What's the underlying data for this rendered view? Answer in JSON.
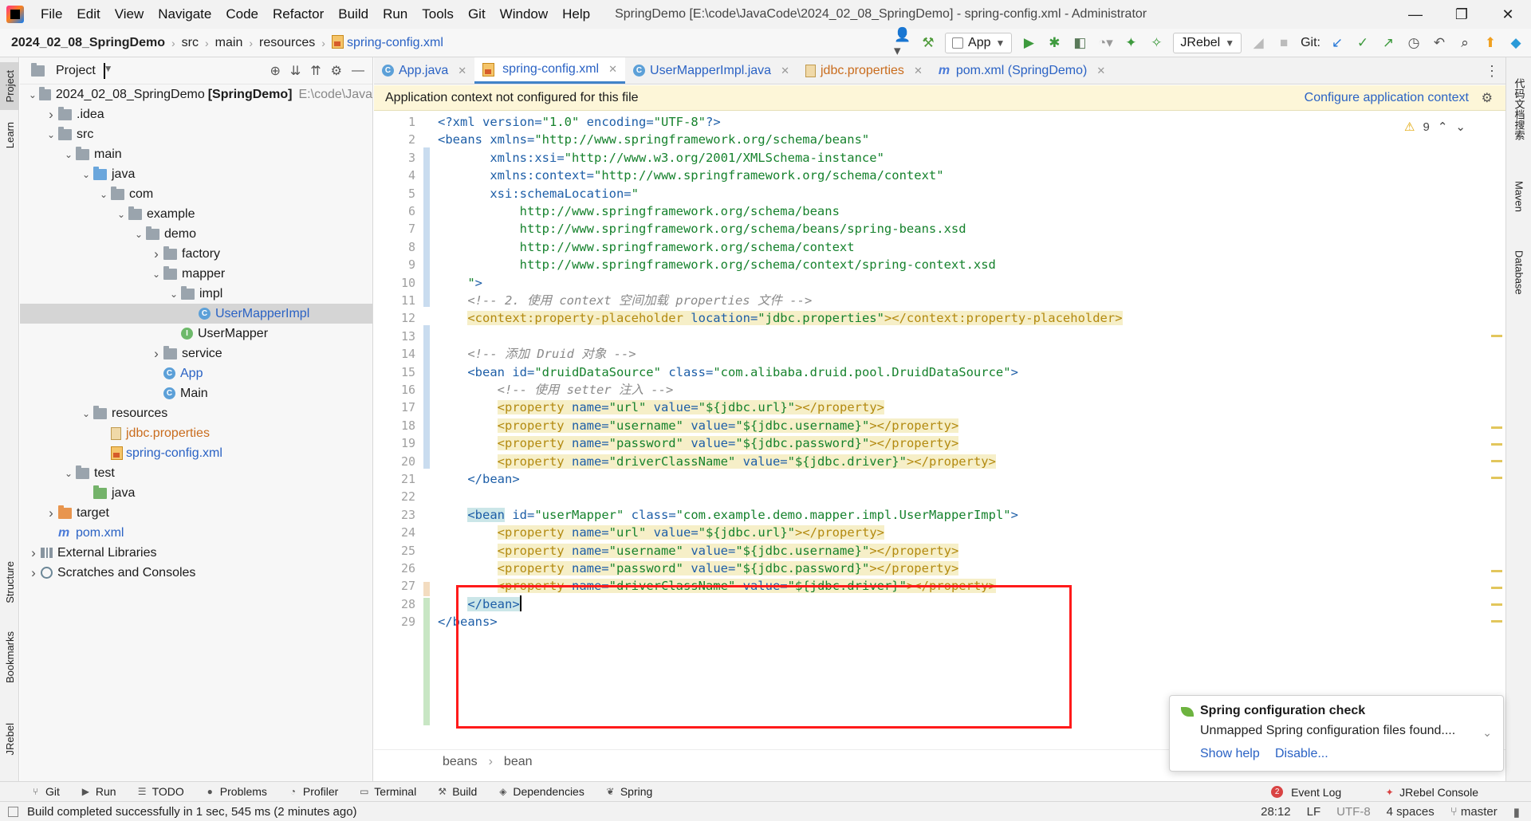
{
  "titlebar": {
    "menu": [
      "File",
      "Edit",
      "View",
      "Navigate",
      "Code",
      "Refactor",
      "Build",
      "Run",
      "Tools",
      "Git",
      "Window",
      "Help"
    ],
    "window_title": "SpringDemo [E:\\code\\JavaCode\\2024_02_08_SpringDemo] - spring-config.xml - Administrator",
    "controls": [
      "—",
      "❐",
      "✕"
    ]
  },
  "navbar": {
    "breadcrumbs": [
      "2024_02_08_SpringDemo",
      "src",
      "main",
      "resources",
      "spring-config.xml"
    ],
    "run_config": "App",
    "jrebel": "JRebel",
    "git_label": "Git:"
  },
  "left_stripe": {
    "tabs": [
      "Project",
      "Learn",
      "Structure",
      "Bookmarks",
      "JRebel"
    ]
  },
  "right_stripe": {
    "tabs": [
      "代码文档搜索",
      "Maven",
      "Database"
    ]
  },
  "project_panel": {
    "title": "Project",
    "tree": [
      {
        "label": "2024_02_08_SpringDemo",
        "bold_suffix": "[SpringDemo]",
        "path": "E:\\code\\Java",
        "icon": "folder",
        "expanded": true,
        "depth": 0
      },
      {
        "label": ".idea",
        "icon": "folder",
        "expanded": false,
        "depth": 1
      },
      {
        "label": "src",
        "icon": "folder",
        "expanded": true,
        "depth": 1
      },
      {
        "label": "main",
        "icon": "folder",
        "expanded": true,
        "depth": 2
      },
      {
        "label": "java",
        "icon": "folder-blue",
        "expanded": true,
        "depth": 3
      },
      {
        "label": "com",
        "icon": "folder",
        "expanded": true,
        "depth": 4
      },
      {
        "label": "example",
        "icon": "folder",
        "expanded": true,
        "depth": 5
      },
      {
        "label": "demo",
        "icon": "folder",
        "expanded": true,
        "depth": 6
      },
      {
        "label": "factory",
        "icon": "folder",
        "expanded": false,
        "depth": 7
      },
      {
        "label": "mapper",
        "icon": "folder",
        "expanded": true,
        "depth": 7
      },
      {
        "label": "impl",
        "icon": "folder",
        "expanded": true,
        "depth": 8
      },
      {
        "label": "UserMapperImpl",
        "icon": "class-icon",
        "depth": 9,
        "selected": true,
        "color": "blue"
      },
      {
        "label": "UserMapper",
        "icon": "interface-icon",
        "depth": 8
      },
      {
        "label": "service",
        "icon": "folder",
        "expanded": false,
        "depth": 7
      },
      {
        "label": "App",
        "icon": "class-icon",
        "depth": 7,
        "color": "blue"
      },
      {
        "label": "Main",
        "icon": "class-icon",
        "depth": 7
      },
      {
        "label": "resources",
        "icon": "folder-res",
        "expanded": true,
        "depth": 3
      },
      {
        "label": "jdbc.properties",
        "icon": "properties-icon",
        "depth": 4,
        "color": "orange"
      },
      {
        "label": "spring-config.xml",
        "icon": "xml-icon",
        "depth": 4,
        "color": "blue"
      },
      {
        "label": "test",
        "icon": "folder",
        "expanded": true,
        "depth": 2
      },
      {
        "label": "java",
        "icon": "folder-green",
        "depth": 3
      },
      {
        "label": "target",
        "icon": "folder-orange",
        "expanded": false,
        "depth": 1
      },
      {
        "label": "pom.xml",
        "icon": "maven-icon",
        "depth": 1,
        "color": "blue"
      },
      {
        "label": "External Libraries",
        "icon": "library-icon",
        "expanded": false,
        "depth": 0
      },
      {
        "label": "Scratches and Consoles",
        "icon": "scratch-icon",
        "expanded": false,
        "depth": 0
      }
    ]
  },
  "editor_tabs": [
    {
      "label": "App.java",
      "icon": "class-icon",
      "active": false,
      "color": "java"
    },
    {
      "label": "spring-config.xml",
      "icon": "xml-icon",
      "active": true,
      "color": "java"
    },
    {
      "label": "UserMapperImpl.java",
      "icon": "class-icon",
      "active": false,
      "color": "java"
    },
    {
      "label": "jdbc.properties",
      "icon": "properties-icon",
      "active": false,
      "color": "orange"
    },
    {
      "label": "pom.xml (SpringDemo)",
      "icon": "maven-icon",
      "active": false,
      "color": "java"
    }
  ],
  "banner": {
    "message": "Application context not configured for this file",
    "action": "Configure application context"
  },
  "inspection": {
    "warnings": "9"
  },
  "code_lines": [
    {
      "n": "1",
      "html": "<span class='t-pi'>&lt;?xml version=</span><span class='t-str'>\"1.0\"</span><span class='t-pi'> encoding=</span><span class='t-str'>\"UTF-8\"</span><span class='t-pi'>?&gt;</span>"
    },
    {
      "n": "2",
      "html": "<span class='t-tag'>&lt;beans </span><span class='t-attr'>xmlns=</span><span class='t-str'>\"http://www.springframework.org/schema/beans\"</span>"
    },
    {
      "n": "3",
      "html": "       <span class='t-attr'>xmlns:xsi=</span><span class='t-str'>\"http://www.w3.org/2001/XMLSchema-instance\"</span>"
    },
    {
      "n": "4",
      "html": "       <span class='t-attr'>xmlns:context=</span><span class='t-str'>\"http://www.springframework.org/schema/context\"</span>"
    },
    {
      "n": "5",
      "html": "       <span class='t-attr'>xsi:schemaLocation=</span><span class='t-str'>\"</span>"
    },
    {
      "n": "6",
      "html": "           <span class='t-str'>http://www.springframework.org/schema/beans</span>"
    },
    {
      "n": "7",
      "html": "           <span class='t-str'>http://www.springframework.org/schema/beans/spring-beans.xsd</span>"
    },
    {
      "n": "8",
      "html": "           <span class='t-str'>http://www.springframework.org/schema/context</span>"
    },
    {
      "n": "9",
      "html": "           <span class='t-str'>http://www.springframework.org/schema/context/spring-context.xsd</span>"
    },
    {
      "n": "10",
      "html": "    <span class='t-str'>\"</span><span class='t-tag'>&gt;</span>"
    },
    {
      "n": "11",
      "html": "    <span class='t-cm'>&lt;!-- 2. 使用 context 空间加载 properties 文件 --&gt;</span>"
    },
    {
      "n": "12",
      "html": "    <span class='hl'><span class='t-tagy'>&lt;context:property-placeholder </span><span class='t-attr'>location=</span><span class='t-str'>\"jdbc.properties\"</span><span class='t-tagy'>&gt;&lt;/context:property-placeholder&gt;</span></span>"
    },
    {
      "n": "13",
      "html": ""
    },
    {
      "n": "14",
      "html": "    <span class='t-cm'>&lt;!-- 添加 Druid 对象 --&gt;</span>"
    },
    {
      "n": "15",
      "html": "    <span class='t-tag'>&lt;bean </span><span class='t-attr'>id=</span><span class='t-str'>\"druidDataSource\"</span> <span class='t-attr'>class=</span><span class='t-str'>\"com.alibaba.druid.pool.DruidDataSource\"</span><span class='t-tag'>&gt;</span>"
    },
    {
      "n": "16",
      "html": "        <span class='t-cm'>&lt;!-- 使用 setter 注入 --&gt;</span>"
    },
    {
      "n": "17",
      "html": "        <span class='hl'><span class='t-tagy'>&lt;property </span><span class='t-attr'>name=</span><span class='t-str'>\"url\"</span> <span class='t-attr'>value=</span><span class='t-str'>\"${jdbc.url}\"</span><span class='t-tagy'>&gt;&lt;/property&gt;</span></span>"
    },
    {
      "n": "18",
      "html": "        <span class='hl'><span class='t-tagy'>&lt;property </span><span class='t-attr'>name=</span><span class='t-str'>\"username\"</span> <span class='t-attr'>value=</span><span class='t-str'>\"${jdbc.username}\"</span><span class='t-tagy'>&gt;&lt;/property&gt;</span></span>"
    },
    {
      "n": "19",
      "html": "        <span class='hl'><span class='t-tagy'>&lt;property </span><span class='t-attr'>name=</span><span class='t-str'>\"password\"</span> <span class='t-attr'>value=</span><span class='t-str'>\"${jdbc.password}\"</span><span class='t-tagy'>&gt;&lt;/property&gt;</span></span>"
    },
    {
      "n": "20",
      "html": "        <span class='hl'><span class='t-tagy'>&lt;property </span><span class='t-attr'>name=</span><span class='t-str'>\"driverClassName\"</span> <span class='t-attr'>value=</span><span class='t-str'>\"${jdbc.driver}\"</span><span class='t-tagy'>&gt;&lt;/property&gt;</span></span>"
    },
    {
      "n": "21",
      "html": "    <span class='t-tag'>&lt;/bean&gt;</span>"
    },
    {
      "n": "22",
      "html": ""
    },
    {
      "n": "23",
      "html": "    <span class='t-tag t-bean-hl'>&lt;bean</span> <span class='t-attr'>id=</span><span class='t-str'>\"userMapper\"</span> <span class='t-attr'>class=</span><span class='t-str'>\"com.example.demo.mapper.impl.UserMapperImpl\"</span><span class='t-tag'>&gt;</span>"
    },
    {
      "n": "24",
      "html": "        <span class='hl'><span class='t-tagy'>&lt;property </span><span class='t-attr'>name=</span><span class='t-str'>\"url\"</span> <span class='t-attr'>value=</span><span class='t-str'>\"${jdbc.url}\"</span><span class='t-tagy'>&gt;&lt;/property&gt;</span></span>"
    },
    {
      "n": "25",
      "html": "        <span class='hl'><span class='t-tagy'>&lt;property </span><span class='t-attr'>name=</span><span class='t-str'>\"username\"</span> <span class='t-attr'>value=</span><span class='t-str'>\"${jdbc.username}\"</span><span class='t-tagy'>&gt;&lt;/property&gt;</span></span>"
    },
    {
      "n": "26",
      "html": "        <span class='hl'><span class='t-tagy'>&lt;property </span><span class='t-attr'>name=</span><span class='t-str'>\"password\"</span> <span class='t-attr'>value=</span><span class='t-str'>\"${jdbc.password}\"</span><span class='t-tagy'>&gt;&lt;/property&gt;</span></span>"
    },
    {
      "n": "27",
      "html": "        <span class='hl'><span class='t-tagy'>&lt;property </span><span class='t-attr'>name=</span><span class='t-str'>\"driverClassName\"</span> <span class='t-attr'>value=</span><span class='t-str'>\"${jdbc.driver}\"</span><span class='t-tagy'>&gt;&lt;/property&gt;</span></span>"
    },
    {
      "n": "28",
      "html": "    <span class='t-tag t-bean-hl'>&lt;/bean&gt;</span><span class='caret'></span>"
    },
    {
      "n": "29",
      "html": "<span class='t-tag'>&lt;/beans&gt;</span>"
    }
  ],
  "editor_crumbs": [
    "beans",
    "bean"
  ],
  "popup": {
    "title": "Spring configuration check",
    "body": "Unmapped Spring configuration files found....",
    "link1": "Show help",
    "link2": "Disable..."
  },
  "tool_windows": {
    "left": [
      {
        "label": "Git",
        "icon": "git-icon"
      },
      {
        "label": "Run",
        "icon": "run-icon"
      },
      {
        "label": "TODO",
        "icon": "todo-icon"
      },
      {
        "label": "Problems",
        "icon": "problems-icon"
      },
      {
        "label": "Profiler",
        "icon": "profiler-icon"
      },
      {
        "label": "Terminal",
        "icon": "terminal-icon"
      },
      {
        "label": "Build",
        "icon": "build-icon"
      },
      {
        "label": "Dependencies",
        "icon": "dependencies-icon"
      },
      {
        "label": "Spring",
        "icon": "spring-icon"
      }
    ],
    "event_log": "Event Log",
    "event_count": "2",
    "jrebel_console": "JRebel Console"
  },
  "statusbar": {
    "message": "Build completed successfully in 1 sec, 545 ms (2 minutes ago)",
    "position": "28:12",
    "line_sep": "LF",
    "encoding": "UTF-8",
    "indent": "4 spaces",
    "branch": "master"
  }
}
